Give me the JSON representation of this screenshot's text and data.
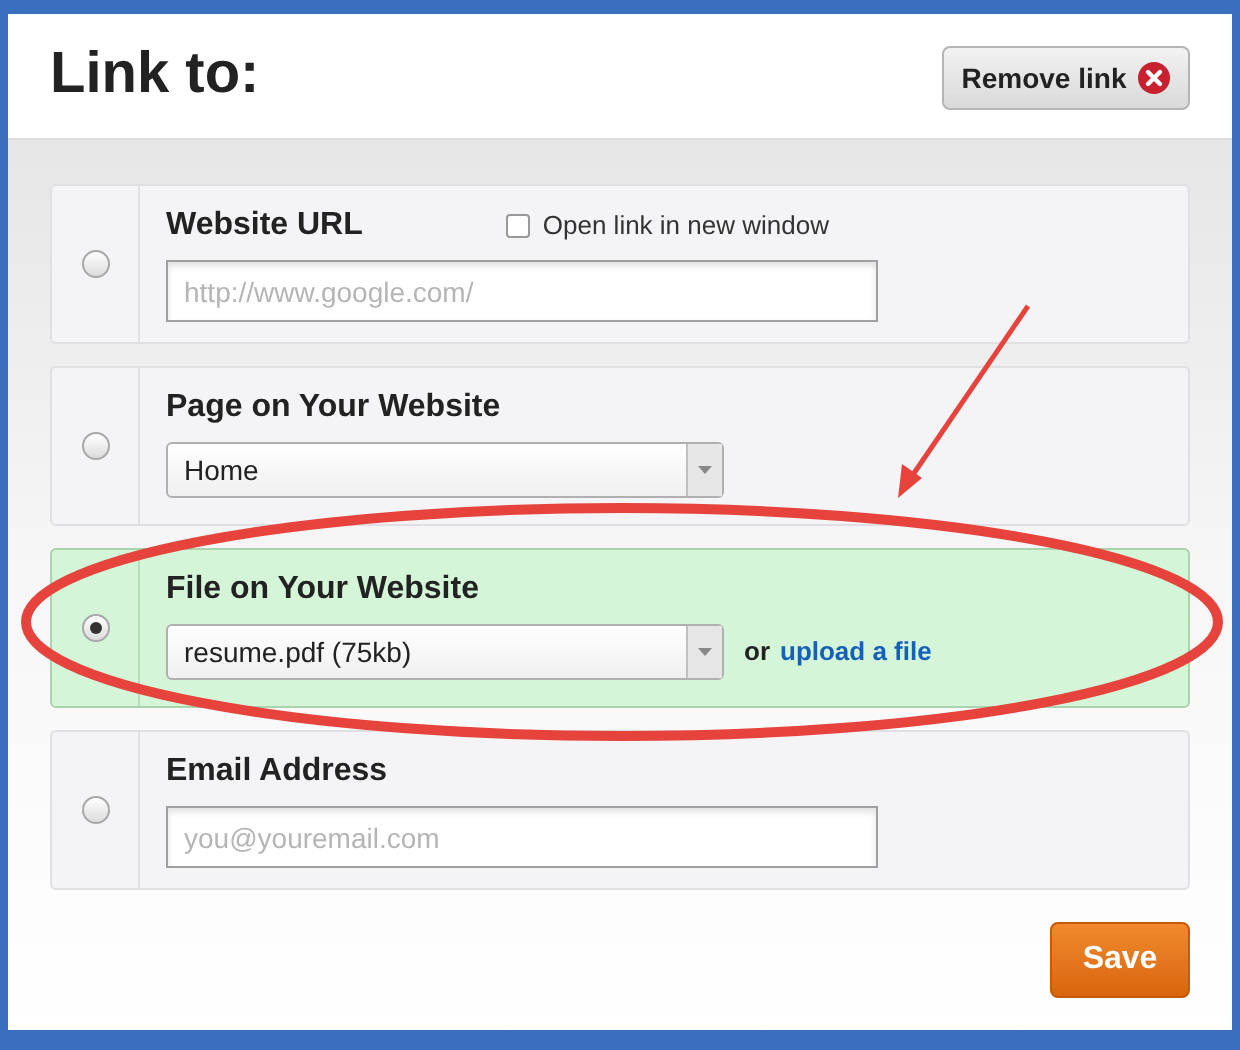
{
  "dialog": {
    "title": "Link to:",
    "remove_button": "Remove link"
  },
  "options": [
    {
      "kind": "field",
      "label": "Website URL",
      "selected": false,
      "checkbox": {
        "label": "Open link in new window",
        "checked": false
      },
      "placeholder": "http://www.google.com/"
    },
    {
      "kind": "select",
      "label": "Page on Your Website",
      "selected": false,
      "value": "Home"
    },
    {
      "kind": "select",
      "label": "File on Your Website",
      "selected": true,
      "value": "resume.pdf (75kb)",
      "or_text": "or",
      "link": "upload a file"
    },
    {
      "kind": "field",
      "label": "Email Address",
      "selected": false,
      "placeholder": "you@youremail.com"
    }
  ],
  "save_button": "Save"
}
